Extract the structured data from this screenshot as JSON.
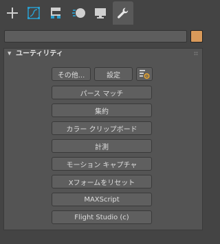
{
  "tabs": [
    {
      "icon": "create-plus-icon"
    },
    {
      "icon": "modify-bend-icon"
    },
    {
      "icon": "hierarchy-icon"
    },
    {
      "icon": "motion-icon"
    },
    {
      "icon": "display-monitor-icon"
    },
    {
      "icon": "utilities-wrench-icon",
      "active": true
    }
  ],
  "name_field": {
    "value": ""
  },
  "object_color": "#d99a5a",
  "rollout": {
    "title": "ユーティリティ",
    "collapse_glyph": "▼",
    "top_buttons": {
      "more": "その他...",
      "sets": "設定"
    },
    "config_icon": "configure-button-sets-icon",
    "utility_buttons": [
      "パース マッチ",
      "集約",
      "カラー クリップボード",
      "計測",
      "モーション キャプチャ",
      "Xフォームをリセット",
      "MAXScript",
      "Flight Studio (c)"
    ]
  },
  "colors": {
    "background": "#444444",
    "panel": "#545454",
    "button": "#5f5f5f",
    "accent_icon": "#2a9fd0",
    "config_gear": "#e0a030"
  }
}
